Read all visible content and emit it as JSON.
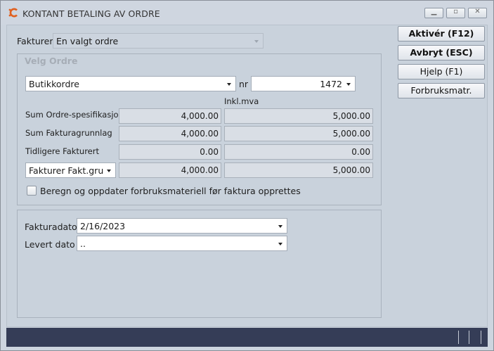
{
  "window": {
    "title": "KONTANT BETALING AV ORDRE",
    "controls": [
      "minimize-icon",
      "restore-icon",
      "close-icon"
    ]
  },
  "fakturer": {
    "label": "Fakturer",
    "value": "En valgt ordre"
  },
  "velg_ordre": {
    "title": "Velg Ordre",
    "order_type": "Butikkordre",
    "nr_label": "nr",
    "nr_value": "1472",
    "inkl_header": "Inkl.mva",
    "rows": [
      {
        "label": "Sum Ordre-spesifikasjon",
        "ex": "4,000.00",
        "inkl": "5,000.00"
      },
      {
        "label": "Sum Fakturagrunnlag",
        "ex": "4,000.00",
        "inkl": "5,000.00"
      },
      {
        "label": "Tidligere Fakturert",
        "ex": "0.00",
        "inkl": "0.00"
      }
    ],
    "fakturer_row": {
      "select": "Fakturer Fakt.grunnlag",
      "ex": "4,000.00",
      "inkl": "5,000.00"
    },
    "checkbox_label": "Beregn og oppdater forbruksmateriell før faktura opprettes",
    "checkbox_checked": false
  },
  "dates": {
    "fakturadato_label": "Fakturadato",
    "fakturadato_value": "2/16/2023",
    "levert_label": "Levert dato",
    "levert_value": ".."
  },
  "buttons": {
    "aktiver": "Aktivér (F12)",
    "avbryt": "Avbryt (ESC)",
    "hjelp": "Hjelp (F1)",
    "forbruk": "Forbruksmatr."
  }
}
